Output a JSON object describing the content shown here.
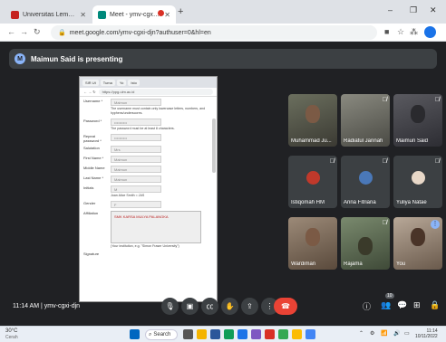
{
  "browser": {
    "tabs": [
      {
        "label": "Universitas Lembung Mangkurat",
        "close": "✕"
      },
      {
        "label": "Meet - ymv-cgxi-djn",
        "close": "✕"
      }
    ],
    "new_tab": "+",
    "window_controls": {
      "minimize": "–",
      "restore": "❐",
      "close": "✕"
    },
    "url": "meet.google.com/ymv-cgxi-djn?authuser=0&hl=en"
  },
  "meet": {
    "presenter_banner": "Maimun Said is presenting",
    "meeting_time": "11:14 AM",
    "meeting_code": "ymv-cgxi-djn",
    "participant_badge": "10"
  },
  "shared_screen": {
    "tabs": [
      "SIR Ut",
      "Tuma",
      "Yo",
      "Isto"
    ],
    "url": "https://ppg.ulm.ac.id",
    "fields": [
      {
        "label": "Username *",
        "value": "Maimun",
        "hint": "The username must contain only lowercase letters, numbers, and hyphens/underscores."
      },
      {
        "label": "Password *",
        "value": "••••••••••",
        "hint": "The password must be at least 8 characters."
      },
      {
        "label": "Repeat password *",
        "value": "••••••••••",
        "hint": ""
      },
      {
        "label": "Salutation",
        "value": "Mrs",
        "hint": ""
      },
      {
        "label": "First Name *",
        "value": "Maimun",
        "hint": ""
      },
      {
        "label": "Middle Name",
        "value": "Maimun",
        "hint": ""
      },
      {
        "label": "Last Name *",
        "value": "Maimun",
        "hint": ""
      },
      {
        "label": "Initials",
        "value": "M",
        "hint": "Joan Alice Smith = JAS"
      },
      {
        "label": "Gender",
        "value": "F",
        "hint": ""
      }
    ],
    "affiliation_label": "Affiliation",
    "affiliation_value": "SMK KARSA MULYA PALANGKA",
    "affiliation_hint": "(Your institution, e.g. \"Simon Fraser University\")",
    "signature_label": "Signature"
  },
  "participants": [
    {
      "name": "Muhammad Ju...",
      "muted": false
    },
    {
      "name": "Radiatul Jannah",
      "muted": true
    },
    {
      "name": "Maimun Said",
      "muted": true
    },
    {
      "name": "Istiqomah HM",
      "muted": true,
      "avatar_color": "#c0392b"
    },
    {
      "name": "Arina Fitriana",
      "muted": true,
      "avatar_color": "#4a78b8"
    },
    {
      "name": "Yuliya Natae",
      "muted": true,
      "avatar_color": "#e8d8c8"
    },
    {
      "name": "Wardiman",
      "muted": false
    },
    {
      "name": "Rajama",
      "muted": true
    },
    {
      "name": "You",
      "muted": false
    }
  ],
  "taskbar": {
    "weather_temp": "30°C",
    "weather_desc": "Cerah",
    "search_label": "Search",
    "time": "11:14",
    "date": "10/11/2022"
  },
  "colors": {
    "meet_bg": "#202124",
    "end_call": "#ea4335",
    "accent": "#1a73e8"
  }
}
